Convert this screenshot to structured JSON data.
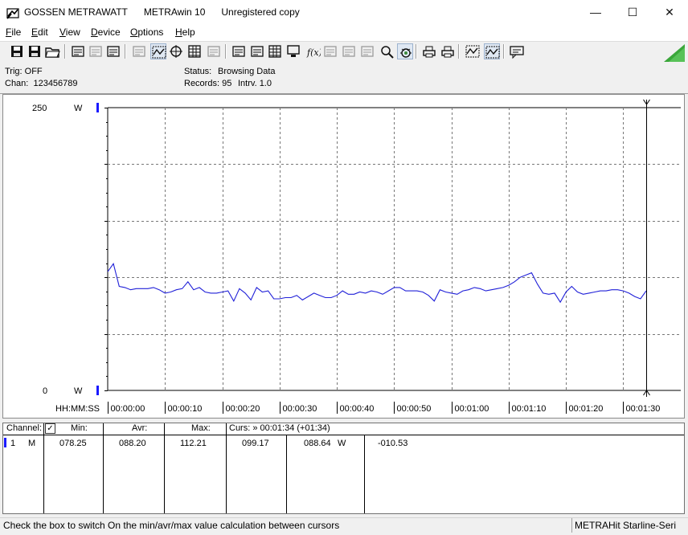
{
  "window": {
    "app_name": "GOSSEN METRAWATT",
    "program": "METRAwin 10",
    "license": "Unregistered copy",
    "minimize_glyph": "—",
    "maximize_glyph": "☐",
    "close_glyph": "✕"
  },
  "menu": {
    "items": [
      {
        "label": "File",
        "key": "F",
        "rest": "ile"
      },
      {
        "label": "Edit",
        "key": "E",
        "rest": "dit"
      },
      {
        "label": "View",
        "key": "V",
        "rest": "iew"
      },
      {
        "label": "Device",
        "key": "D",
        "rest": "evice"
      },
      {
        "label": "Options",
        "key": "O",
        "rest": "ptions"
      },
      {
        "label": "Help",
        "key": "H",
        "rest": "elp"
      }
    ]
  },
  "toolbar": {
    "icons": [
      "save-icon",
      "save-as-icon",
      "open-folder-icon",
      "device-read-icon",
      "device-memory-icon",
      "device-export-icon",
      "keyboard-icon",
      "trend-chart-icon",
      "crosshair-icon",
      "table-view-icon",
      "bar-chart-icon",
      "window-copy-icon",
      "window-paste-icon",
      "data-list-icon",
      "computer-icon",
      "function-icon",
      "signal-wave-icon",
      "pulse-wave-icon",
      "sine-wave-icon",
      "zoom-search-icon",
      "trigger-bug-icon",
      "print-icon",
      "print-setup-icon",
      "zoom-wave-icon",
      "zoom-fit-icon",
      "message-icon"
    ]
  },
  "info": {
    "trig": "Trig: OFF",
    "chan": "Chan:  123456789",
    "status_label": "Status:",
    "status_value": "Browsing Data",
    "records_label": "Records: 95",
    "interval_label": "Intrv. 1.0"
  },
  "chart_data": {
    "type": "line",
    "title": "",
    "xlabel": "HH:MM:SS",
    "ylabel": "W",
    "ylim": [
      0,
      250
    ],
    "y_ticks": [
      "250",
      "0"
    ],
    "y_unit": "W",
    "x_ticks": [
      "00:00:00",
      "00:00:10",
      "00:00:20",
      "00:00:30",
      "00:00:40",
      "00:00:50",
      "00:01:00",
      "00:01:10",
      "00:01:20",
      "00:01:30"
    ],
    "grid": true,
    "x_seconds": [
      0,
      1,
      2,
      3,
      4,
      5,
      6,
      7,
      8,
      9,
      10,
      11,
      12,
      13,
      14,
      15,
      16,
      17,
      18,
      19,
      20,
      21,
      22,
      23,
      24,
      25,
      26,
      27,
      28,
      29,
      30,
      31,
      32,
      33,
      34,
      35,
      36,
      37,
      38,
      39,
      40,
      41,
      42,
      43,
      44,
      45,
      46,
      47,
      48,
      49,
      50,
      51,
      52,
      53,
      54,
      55,
      56,
      57,
      58,
      59,
      60,
      61,
      62,
      63,
      64,
      65,
      66,
      67,
      68,
      69,
      70,
      71,
      72,
      73,
      74,
      75,
      76,
      77,
      78,
      79,
      80,
      81,
      82,
      83,
      84,
      85,
      86,
      87,
      88,
      89,
      90,
      91,
      92,
      93,
      94
    ],
    "series": [
      {
        "values": [
          105,
          112,
          92,
          91,
          91,
          89,
          90,
          90,
          90,
          91,
          89,
          87,
          86,
          87,
          89,
          90,
          96,
          89,
          89,
          91,
          87,
          86,
          86,
          87,
          88,
          87,
          79,
          90,
          86,
          80,
          91,
          87,
          88,
          83,
          81,
          81,
          82,
          82,
          84,
          80,
          78,
          83,
          86,
          84,
          82,
          82,
          84,
          87,
          88,
          85,
          85,
          87,
          86,
          88,
          88,
          87,
          85,
          88,
          91,
          91,
          88,
          88,
          89,
          88,
          87,
          84,
          79,
          89,
          87,
          85,
          86,
          85,
          88,
          89,
          91,
          90,
          88,
          88,
          89,
          90,
          91,
          93,
          96,
          100,
          103,
          102,
          104,
          94,
          86,
          85,
          86,
          78,
          78,
          87,
          92,
          87,
          85,
          86,
          88,
          87,
          88,
          88,
          89,
          89,
          88,
          87,
          86,
          83,
          81,
          88
        ]
      }
    ],
    "cursor_x": 94
  },
  "grid_table": {
    "headers": {
      "channel": "Channel:",
      "check": "☑",
      "min": "Min:",
      "avr": "Avr:",
      "max": "Max:",
      "curs": "Curs: » 00:01:34 (+01:34)"
    },
    "row": {
      "chan": "1",
      "mode": "M",
      "min": "078.25",
      "avr": "088.20",
      "max": "112.21",
      "curs1": "099.17",
      "curs2": "088.64",
      "unit": "W",
      "delta": "-010.53"
    },
    "channel_color": "#1a1aff"
  },
  "status": {
    "hint": "Check the box to switch On the min/avr/max value calculation between cursors",
    "device": "METRAHit Starline-Seri"
  }
}
